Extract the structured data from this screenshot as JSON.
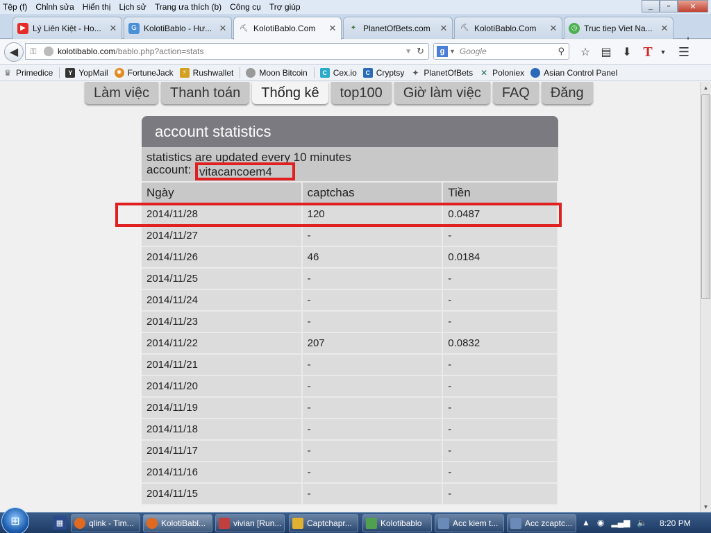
{
  "menubar": {
    "items": [
      "Tệp (f)",
      "Chỉnh sửa",
      "Hiển thị",
      "Lịch sử",
      "Trang ưa thích (b)",
      "Công cụ",
      "Trợ giúp"
    ]
  },
  "tabs": [
    {
      "label": "Lý Liên Kiệt - Ho...",
      "icon": "youtube-icon",
      "color": "#e52d27"
    },
    {
      "label": "KolotiBablo - Hư...",
      "icon": "koloti-icon",
      "color": "#4a90d9"
    },
    {
      "label": "KolotiBablo.Com",
      "icon": "pickaxe-icon",
      "color": "#666666"
    },
    {
      "label": "PlanetOfBets.com",
      "icon": "planetofbets-icon",
      "color": "#3a7a3a"
    },
    {
      "label": "KolotiBablo.Com",
      "icon": "pickaxe-icon",
      "color": "#666666"
    },
    {
      "label": "Truc tiep Viet Na...",
      "icon": "clock-icon",
      "color": "#4caf50"
    }
  ],
  "navbar": {
    "url_host": "kolotibablo.com",
    "url_path": "/bablo.php?action=stats",
    "search_placeholder": "Google"
  },
  "bookmarks": [
    {
      "label": "Primedice",
      "icon": "crown-icon",
      "color": "#777777"
    },
    {
      "label": "YopMail",
      "icon": "yopmail-icon",
      "color": "#333333"
    },
    {
      "label": "FortuneJack",
      "icon": "fortunejack-icon",
      "color": "#e08a20"
    },
    {
      "label": "Rushwallet",
      "icon": "rushwallet-icon",
      "color": "#d4a020"
    },
    {
      "label": "Moon Bitcoin",
      "icon": "moon-icon",
      "color": "#999999"
    },
    {
      "label": "Cex.io",
      "icon": "cexio-icon",
      "color": "#2aa9c8"
    },
    {
      "label": "Cryptsy",
      "icon": "cryptsy-icon",
      "color": "#2a6ab8"
    },
    {
      "label": "PlanetOfBets",
      "icon": "planetofbets-icon",
      "color": "#555555"
    },
    {
      "label": "Poloniex",
      "icon": "poloniex-icon",
      "color": "#1a6a5a"
    },
    {
      "label": "Asian Control Panel",
      "icon": "globe-icon",
      "color": "#2a6ab8"
    }
  ],
  "page_tabs": [
    "Làm việc",
    "Thanh toán",
    "Thống kê",
    "top100",
    "Giờ làm việc",
    "FAQ",
    "Đăng"
  ],
  "panel": {
    "title": "account statistics",
    "info_line": "statistics are updated every 10 minutes",
    "account_label": "account:",
    "account_value": "vitacancoem4"
  },
  "table": {
    "headers": [
      "Ngày",
      "captchas",
      "Tiền"
    ],
    "rows": [
      [
        "2014/11/28",
        "120",
        "0.0487"
      ],
      [
        "2014/11/27",
        "-",
        "-"
      ],
      [
        "2014/11/26",
        "46",
        "0.0184"
      ],
      [
        "2014/11/25",
        "-",
        "-"
      ],
      [
        "2014/11/24",
        "-",
        "-"
      ],
      [
        "2014/11/23",
        "-",
        "-"
      ],
      [
        "2014/11/22",
        "207",
        "0.0832"
      ],
      [
        "2014/11/21",
        "-",
        "-"
      ],
      [
        "2014/11/20",
        "-",
        "-"
      ],
      [
        "2014/11/19",
        "-",
        "-"
      ],
      [
        "2014/11/18",
        "-",
        "-"
      ],
      [
        "2014/11/17",
        "-",
        "-"
      ],
      [
        "2014/11/16",
        "-",
        "-"
      ],
      [
        "2014/11/15",
        "-",
        "-"
      ]
    ]
  },
  "taskbar": {
    "tasks": [
      {
        "label": "qlink - Tim...",
        "icon": "firefox-icon",
        "color": "#e06a20"
      },
      {
        "label": "KolotiBabl...",
        "icon": "firefox-icon",
        "color": "#e06a20"
      },
      {
        "label": "vivian [Run...",
        "icon": "app-icon",
        "color": "#c04040"
      },
      {
        "label": "Captchapr...",
        "icon": "folder-icon",
        "color": "#e0b030"
      },
      {
        "label": "Kolotibablo",
        "icon": "notepad-icon",
        "color": "#50a050"
      },
      {
        "label": "Acc kiem t...",
        "icon": "document-icon",
        "color": "#6a8ab8"
      },
      {
        "label": "Acc zcaptc...",
        "icon": "document-icon",
        "color": "#6a8ab8"
      }
    ],
    "clock": "8:20 PM"
  },
  "accent": {
    "highlight": "#e02020",
    "panel_header": "#7a7a80"
  }
}
